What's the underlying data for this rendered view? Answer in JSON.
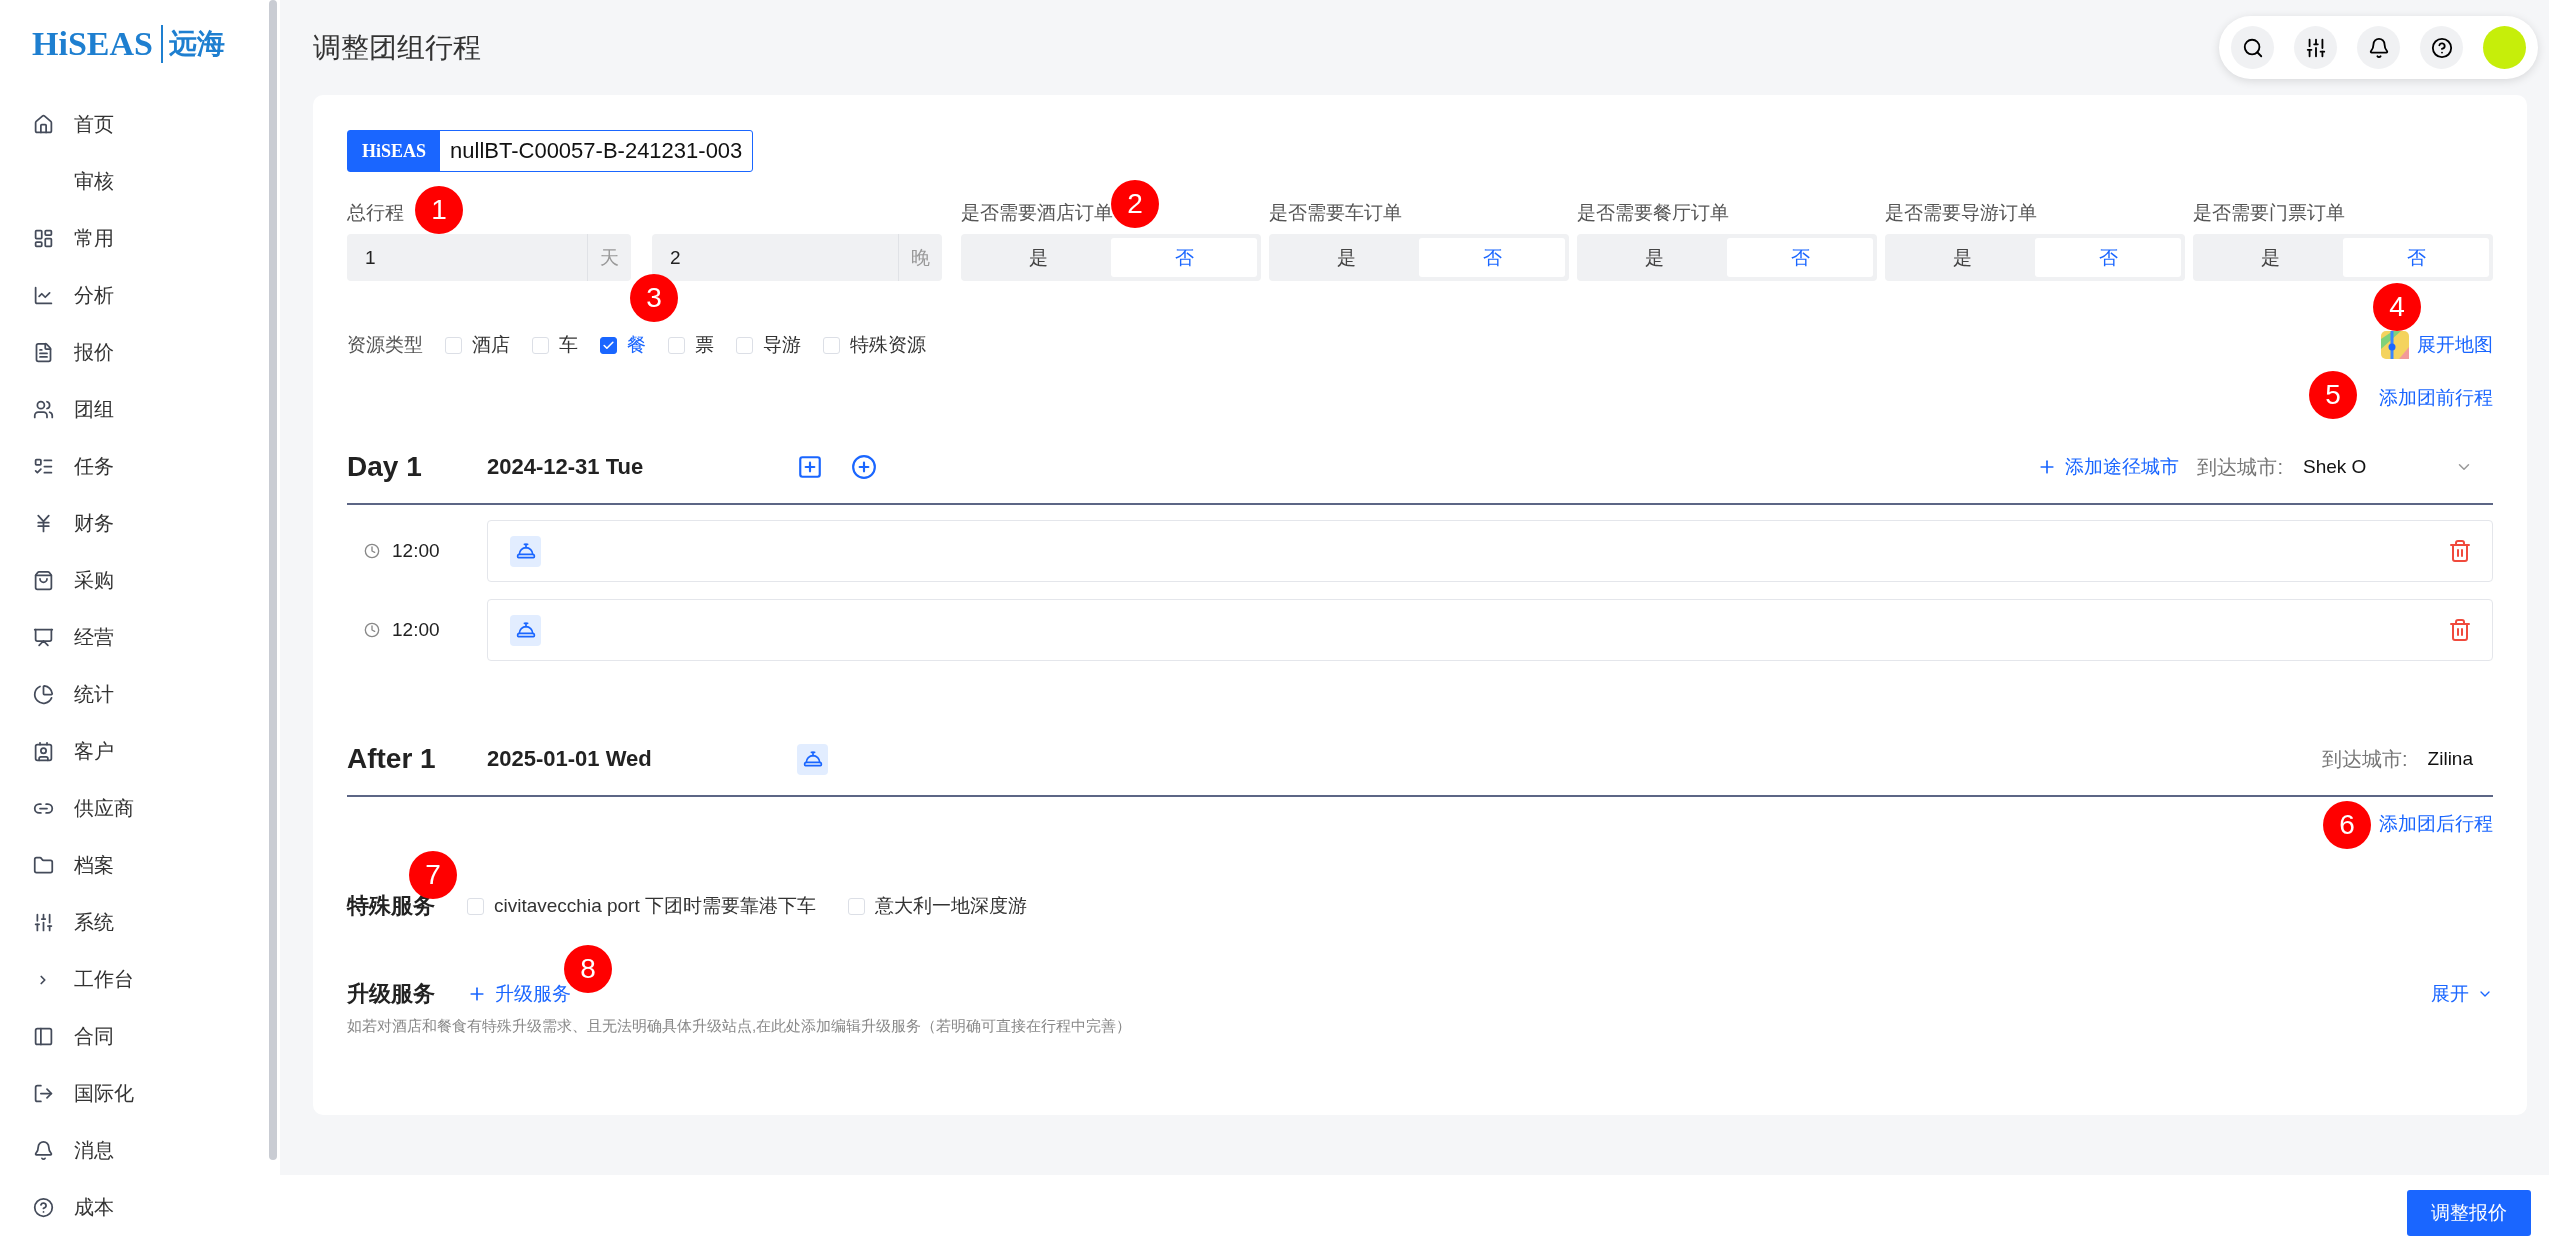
{
  "logo": {
    "latin": "HiSEAS",
    "chinese": "远海"
  },
  "sidebar": {
    "items": [
      {
        "label": "首页"
      },
      {
        "label": "审核"
      },
      {
        "label": "常用"
      },
      {
        "label": "分析"
      },
      {
        "label": "报价"
      },
      {
        "label": "团组"
      },
      {
        "label": "任务"
      },
      {
        "label": "财务"
      },
      {
        "label": "采购"
      },
      {
        "label": "经营"
      },
      {
        "label": "统计"
      },
      {
        "label": "客户"
      },
      {
        "label": "供应商"
      },
      {
        "label": "档案"
      },
      {
        "label": "系统"
      },
      {
        "label": "工作台"
      },
      {
        "label": "合同"
      },
      {
        "label": "国际化"
      },
      {
        "label": "消息"
      },
      {
        "label": "成本"
      }
    ]
  },
  "header": {
    "title": "调整团组行程"
  },
  "booking": {
    "brand": "HiSEAS",
    "code": "nullBT-C00057-B-241231-003"
  },
  "total": {
    "label": "总行程",
    "marker": "1",
    "days": {
      "value": "1",
      "unit": "天"
    },
    "nights": {
      "value": "2",
      "unit": "晚"
    }
  },
  "orders": [
    {
      "label": "是否需要酒店订单",
      "marker": "2",
      "options": [
        {
          "label": "是",
          "selected": false
        },
        {
          "label": "否",
          "selected": true
        }
      ]
    },
    {
      "label": "是否需要车订单",
      "options": [
        {
          "label": "是",
          "selected": false
        },
        {
          "label": "否",
          "selected": true
        }
      ]
    },
    {
      "label": "是否需要餐厅订单",
      "options": [
        {
          "label": "是",
          "selected": false
        },
        {
          "label": "否",
          "selected": true
        }
      ]
    },
    {
      "label": "是否需要导游订单",
      "options": [
        {
          "label": "是",
          "selected": false
        },
        {
          "label": "否",
          "selected": true
        }
      ]
    },
    {
      "label": "是否需要门票订单",
      "options": [
        {
          "label": "是",
          "selected": false
        },
        {
          "label": "否",
          "selected": true
        }
      ]
    }
  ],
  "resource_types": {
    "label": "资源类型",
    "marker": "3",
    "options": [
      {
        "label": "酒店",
        "checked": false
      },
      {
        "label": "车",
        "checked": false
      },
      {
        "label": "餐",
        "checked": true
      },
      {
        "label": "票",
        "checked": false
      },
      {
        "label": "导游",
        "checked": false
      },
      {
        "label": "特殊资源",
        "checked": false
      }
    ]
  },
  "map_link": {
    "label": "展开地图",
    "marker": "4"
  },
  "pre_trip_link": {
    "label": "添加团前行程",
    "marker": "5"
  },
  "days": [
    {
      "kind": "day",
      "title": "Day 1",
      "date": "2024-12-31 Tue",
      "add_city": "添加途径城市",
      "arrival_label": "到达城市:",
      "arrival_city": "Shek O",
      "entries": [
        {
          "time": "12:00"
        },
        {
          "time": "12:00"
        }
      ]
    },
    {
      "kind": "after",
      "title": "After 1",
      "date": "2025-01-01 Wed",
      "arrival_label": "到达城市:",
      "arrival_city": "Zilina"
    }
  ],
  "post_trip_link": {
    "label": "添加团后行程",
    "marker": "6"
  },
  "special_services": {
    "title": "特殊服务",
    "marker": "7",
    "options": [
      {
        "label": "civitavecchia port 下团时需要靠港下车",
        "checked": false
      },
      {
        "label": "意大利一地深度游",
        "checked": false
      }
    ]
  },
  "upgrade": {
    "title": "升级服务",
    "add_label": "升级服务",
    "marker": "8",
    "expand_label": "展开",
    "hint": "如若对酒店和餐食有特殊升级需求、且无法明确具体升级站点,在此处添加编辑升级服务（若明确可直接在行程中完善）"
  },
  "footer": {
    "button": "调整报价"
  }
}
